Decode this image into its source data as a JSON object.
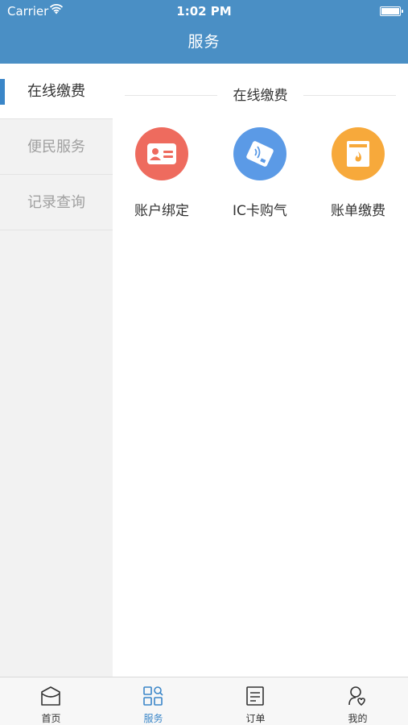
{
  "status_bar": {
    "carrier": "Carrier",
    "time": "1:02 PM"
  },
  "nav": {
    "title": "服务"
  },
  "sidebar": {
    "items": [
      {
        "label": "在线缴费",
        "active": true
      },
      {
        "label": "便民服务",
        "active": false
      },
      {
        "label": "记录查询",
        "active": false
      }
    ]
  },
  "content": {
    "section_title": "在线缴费",
    "items": [
      {
        "label": "账户绑定",
        "icon": "id-card-icon",
        "color": "#ee6b5e"
      },
      {
        "label": "IC卡购气",
        "icon": "ic-card-icon",
        "color": "#5b9ae6"
      },
      {
        "label": "账单缴费",
        "icon": "gas-bill-icon",
        "color": "#f7a93b"
      }
    ]
  },
  "tabbar": {
    "tabs": [
      {
        "label": "首页",
        "icon": "home-icon",
        "active": false
      },
      {
        "label": "服务",
        "icon": "grid-search-icon",
        "active": true
      },
      {
        "label": "订单",
        "icon": "order-icon",
        "active": false
      },
      {
        "label": "我的",
        "icon": "profile-icon",
        "active": false
      }
    ]
  },
  "colors": {
    "accent": "#3a86c8",
    "header": "#4a8fc5"
  }
}
